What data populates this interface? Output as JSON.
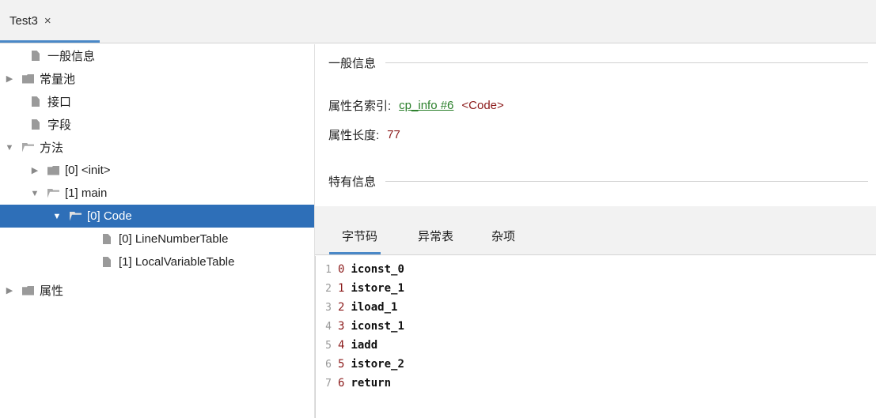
{
  "tab": {
    "title": "Test3",
    "close": "×"
  },
  "tree": [
    {
      "label": "一般信息",
      "type": "file",
      "expander": ""
    },
    {
      "label": "常量池",
      "type": "folder",
      "expander": "▶"
    },
    {
      "label": "接口",
      "type": "file",
      "expander": ""
    },
    {
      "label": "字段",
      "type": "file",
      "expander": ""
    },
    {
      "label": "方法",
      "type": "folder-open",
      "expander": "▼"
    },
    {
      "label": "[0] <init>",
      "type": "folder",
      "expander": "▶"
    },
    {
      "label": "[1] main",
      "type": "folder-open",
      "expander": "▼"
    },
    {
      "label": "[0] Code",
      "type": "folder-open",
      "expander": "▼",
      "selected": true
    },
    {
      "label": "[0] LineNumberTable",
      "type": "file",
      "expander": ""
    },
    {
      "label": "[1] LocalVariableTable",
      "type": "file",
      "expander": ""
    },
    {
      "label": "属性",
      "type": "folder",
      "expander": "▶"
    }
  ],
  "general": {
    "section_title": "一般信息",
    "name_index_label": "属性名索引:",
    "name_index_link": "cp_info #6",
    "name_index_value": "<Code>",
    "length_label": "属性长度:",
    "length_value": "77"
  },
  "specific": {
    "section_title": "特有信息",
    "tabs": [
      "字节码",
      "异常表",
      "杂项"
    ]
  },
  "bytecode": [
    {
      "line": "1",
      "index": "0",
      "instr": "iconst_0"
    },
    {
      "line": "2",
      "index": "1",
      "instr": "istore_1"
    },
    {
      "line": "3",
      "index": "2",
      "instr": "iload_1"
    },
    {
      "line": "4",
      "index": "3",
      "instr": "iconst_1"
    },
    {
      "line": "5",
      "index": "4",
      "instr": "iadd"
    },
    {
      "line": "6",
      "index": "5",
      "instr": "istore_2"
    },
    {
      "line": "7",
      "index": "6",
      "instr": "return"
    }
  ]
}
